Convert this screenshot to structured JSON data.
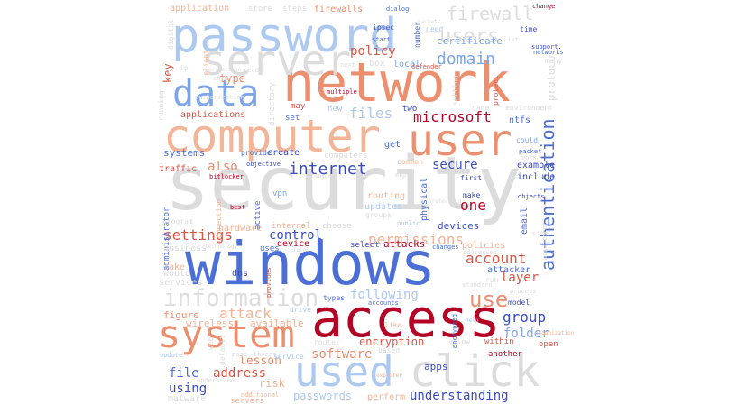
{
  "palette": {
    "darkred": "#b40426",
    "red": "#d85646",
    "salmon": "#ec8f6f",
    "lightsalmon": "#f3b497",
    "grey": "#dcdcdc",
    "lightblue": "#aec9f0",
    "blue": "#7ea5e8",
    "royal": "#4c6fd5",
    "navy": "#3b4cc0"
  },
  "words": [
    {
      "text": "security",
      "size": 82,
      "color": "grey",
      "weight": 1
    },
    {
      "text": "windows",
      "size": 66,
      "color": "royal",
      "weight": 1
    },
    {
      "text": "access",
      "size": 58,
      "color": "darkred",
      "weight": 1
    },
    {
      "text": "network",
      "size": 60,
      "color": "salmon",
      "weight": 1
    },
    {
      "text": "computer",
      "size": 50,
      "color": "lightsalmon",
      "weight": 1
    },
    {
      "text": "user",
      "size": 48,
      "color": "salmon",
      "weight": 1
    },
    {
      "text": "password",
      "size": 52,
      "color": "lightblue",
      "weight": 1
    },
    {
      "text": "server",
      "size": 46,
      "color": "grey",
      "weight": 1
    },
    {
      "text": "data",
      "size": 40,
      "color": "blue",
      "weight": 1
    },
    {
      "text": "system",
      "size": 42,
      "color": "salmon",
      "weight": 1
    },
    {
      "text": "used",
      "size": 46,
      "color": "lightblue",
      "weight": 1
    },
    {
      "text": "click",
      "size": 48,
      "color": "grey",
      "weight": 1
    },
    {
      "text": "information",
      "size": 26,
      "color": "grey",
      "weight": 1
    },
    {
      "text": "authentication",
      "size": 20,
      "color": "royal",
      "weight": 1
    },
    {
      "text": "use",
      "size": 24,
      "color": "salmon",
      "weight": 1
    },
    {
      "text": "users",
      "size": 22,
      "color": "grey",
      "weight": 1
    },
    {
      "text": "firewall",
      "size": 20,
      "color": "grey",
      "weight": 1
    },
    {
      "text": "domain",
      "size": 18,
      "color": "blue",
      "weight": 1
    },
    {
      "text": "internet",
      "size": 18,
      "color": "navy",
      "weight": 1
    },
    {
      "text": "microsoft",
      "size": 16,
      "color": "darkred",
      "weight": 1
    },
    {
      "text": "settings",
      "size": 16,
      "color": "red",
      "weight": 1
    },
    {
      "text": "permissions",
      "size": 16,
      "color": "lightsalmon",
      "weight": 1
    },
    {
      "text": "account",
      "size": 16,
      "color": "red",
      "weight": 1
    },
    {
      "text": "group",
      "size": 16,
      "color": "navy",
      "weight": 1
    },
    {
      "text": "files",
      "size": 16,
      "color": "lightblue",
      "weight": 1
    },
    {
      "text": "policy",
      "size": 14,
      "color": "red",
      "weight": 1
    },
    {
      "text": "control",
      "size": 14,
      "color": "navy",
      "weight": 1
    },
    {
      "text": "also",
      "size": 14,
      "color": "salmon",
      "weight": 1
    },
    {
      "text": "secure",
      "size": 14,
      "color": "navy",
      "weight": 1
    },
    {
      "text": "one",
      "size": 16,
      "color": "darkred",
      "weight": 1
    },
    {
      "text": "following",
      "size": 14,
      "color": "lightblue",
      "weight": 1
    },
    {
      "text": "attack",
      "size": 16,
      "color": "lightsalmon",
      "weight": 1
    },
    {
      "text": "understanding",
      "size": 14,
      "color": "navy",
      "weight": 1
    },
    {
      "text": "software",
      "size": 14,
      "color": "salmon",
      "weight": 1
    },
    {
      "text": "encryption",
      "size": 12,
      "color": "red",
      "weight": 1
    },
    {
      "text": "folder",
      "size": 14,
      "color": "blue",
      "weight": 1
    },
    {
      "text": "layer",
      "size": 14,
      "color": "red",
      "weight": 1
    },
    {
      "text": "address",
      "size": 14,
      "color": "red",
      "weight": 1
    },
    {
      "text": "file",
      "size": 14,
      "color": "royal",
      "weight": 1
    },
    {
      "text": "using",
      "size": 14,
      "color": "navy",
      "weight": 1
    },
    {
      "text": "lesson",
      "size": 13,
      "color": "salmon",
      "weight": 1
    },
    {
      "text": "risk",
      "size": 12,
      "color": "lightsalmon",
      "weight": 1
    },
    {
      "text": "type",
      "size": 12,
      "color": "salmon",
      "weight": 1
    },
    {
      "text": "key",
      "size": 12,
      "color": "red",
      "weight": 1
    },
    {
      "text": "certificate",
      "size": 11,
      "color": "blue",
      "weight": 1
    },
    {
      "text": "protocol",
      "size": 12,
      "color": "grey",
      "weight": 1
    },
    {
      "text": "passwords",
      "size": 12,
      "color": "lightblue",
      "weight": 1
    },
    {
      "text": "apps",
      "size": 11,
      "color": "navy",
      "weight": 1
    },
    {
      "text": "attacks",
      "size": 11,
      "color": "darkred",
      "weight": 1
    },
    {
      "text": "devices",
      "size": 11,
      "color": "navy",
      "weight": 1
    },
    {
      "text": "figure",
      "size": 11,
      "color": "salmon",
      "weight": 1
    },
    {
      "text": "wireless",
      "size": 11,
      "color": "lightsalmon",
      "weight": 1
    },
    {
      "text": "available",
      "size": 11,
      "color": "lightsalmon",
      "weight": 1
    },
    {
      "text": "systems",
      "size": 11,
      "color": "royal",
      "weight": 1
    },
    {
      "text": "applications",
      "size": 10,
      "color": "red",
      "weight": 1
    },
    {
      "text": "create",
      "size": 10,
      "color": "navy",
      "weight": 1
    },
    {
      "text": "updates",
      "size": 10,
      "color": "lightblue",
      "weight": 1
    },
    {
      "text": "routing",
      "size": 10,
      "color": "lightsalmon",
      "weight": 1
    },
    {
      "text": "email",
      "size": 10,
      "color": "royal",
      "weight": 1
    },
    {
      "text": "physical",
      "size": 10,
      "color": "royal",
      "weight": 1
    },
    {
      "text": "example",
      "size": 10,
      "color": "navy",
      "weight": 1
    },
    {
      "text": "include",
      "size": 10,
      "color": "navy",
      "weight": 1
    },
    {
      "text": "attacker",
      "size": 10,
      "color": "royal",
      "weight": 1
    },
    {
      "text": "policies",
      "size": 10,
      "color": "lightsalmon",
      "weight": 1
    },
    {
      "text": "traffic",
      "size": 10,
      "color": "red",
      "weight": 1
    },
    {
      "text": "hardware",
      "size": 10,
      "color": "lightsalmon",
      "weight": 1
    },
    {
      "text": "administrator",
      "size": 9,
      "color": "royal",
      "weight": 1
    },
    {
      "text": "dns",
      "size": 10,
      "color": "navy",
      "weight": 1
    },
    {
      "text": "get",
      "size": 10,
      "color": "royal",
      "weight": 1
    },
    {
      "text": "ntfs",
      "size": 10,
      "color": "royal",
      "weight": 1
    },
    {
      "text": "application",
      "size": 10,
      "color": "lightsalmon",
      "weight": 1
    },
    {
      "text": "store",
      "size": 9,
      "color": "grey",
      "weight": 1
    },
    {
      "text": "steps",
      "size": 9,
      "color": "grey",
      "weight": 1
    },
    {
      "text": "firewalls",
      "size": 10,
      "color": "salmon",
      "weight": 1
    },
    {
      "text": "directory",
      "size": 9,
      "color": "grey",
      "weight": 1
    },
    {
      "text": "business",
      "size": 10,
      "color": "grey",
      "weight": 1
    },
    {
      "text": "take",
      "size": 10,
      "color": "lightsalmon",
      "weight": 1
    },
    {
      "text": "would",
      "size": 10,
      "color": "grey",
      "weight": 1
    },
    {
      "text": "services",
      "size": 10,
      "color": "grey",
      "weight": 1
    },
    {
      "text": "malware",
      "size": 10,
      "color": "grey",
      "weight": 1
    },
    {
      "text": "servers",
      "size": 9,
      "color": "lightsalmon",
      "weight": 1
    },
    {
      "text": "perform",
      "size": 10,
      "color": "lightsalmon",
      "weight": 1
    },
    {
      "text": "another",
      "size": 9,
      "color": "darkred",
      "weight": 1
    },
    {
      "text": "within",
      "size": 9,
      "color": "red",
      "weight": 1
    },
    {
      "text": "open",
      "size": 9,
      "color": "red",
      "weight": 1
    },
    {
      "text": "select",
      "size": 9,
      "color": "navy",
      "weight": 1
    },
    {
      "text": "choose",
      "size": 9,
      "color": "grey",
      "weight": 1
    },
    {
      "text": "box",
      "size": 10,
      "color": "grey",
      "weight": 1
    },
    {
      "text": "local",
      "size": 10,
      "color": "blue",
      "weight": 1
    },
    {
      "text": "vpn",
      "size": 9,
      "color": "blue",
      "weight": 1
    },
    {
      "text": "internal",
      "size": 9,
      "color": "lightsalmon",
      "weight": 1
    },
    {
      "text": "device",
      "size": 10,
      "color": "darkred",
      "weight": 1
    },
    {
      "text": "uses",
      "size": 9,
      "color": "royal",
      "weight": 1
    },
    {
      "text": "active",
      "size": 9,
      "color": "royal",
      "weight": 1
    },
    {
      "text": "set",
      "size": 9,
      "color": "royal",
      "weight": 1
    },
    {
      "text": "two",
      "size": 9,
      "color": "navy",
      "weight": 1
    },
    {
      "text": "new",
      "size": 9,
      "color": "lightblue",
      "weight": 1
    },
    {
      "text": "may",
      "size": 9,
      "color": "red",
      "weight": 1
    },
    {
      "text": "computers",
      "size": 9,
      "color": "grey",
      "weight": 1
    },
    {
      "text": "provide",
      "size": 8,
      "color": "royal",
      "weight": 1
    },
    {
      "text": "make",
      "size": 8,
      "color": "navy",
      "weight": 1
    },
    {
      "text": "first",
      "size": 8,
      "color": "navy",
      "weight": 1
    },
    {
      "text": "could",
      "size": 8,
      "color": "blue",
      "weight": 1
    },
    {
      "text": "many",
      "size": 8,
      "color": "grey",
      "weight": 1
    },
    {
      "text": "time",
      "size": 8,
      "color": "navy",
      "weight": 1
    },
    {
      "text": "need",
      "size": 8,
      "color": "lightblue",
      "weight": 1
    },
    {
      "text": "number",
      "size": 8,
      "color": "royal",
      "weight": 1
    },
    {
      "text": "ipsec",
      "size": 8,
      "color": "navy",
      "weight": 1
    },
    {
      "text": "start",
      "size": 7,
      "color": "royal",
      "weight": 1
    },
    {
      "text": "dialog",
      "size": 7,
      "color": "royal",
      "weight": 1
    },
    {
      "text": "change",
      "size": 7,
      "color": "darkred",
      "weight": 1
    },
    {
      "text": "networks",
      "size": 7,
      "color": "royal",
      "weight": 1
    },
    {
      "text": "support.",
      "size": 7,
      "color": "navy",
      "weight": 1
    },
    {
      "text": "next",
      "size": 7,
      "color": "grey",
      "weight": 1
    },
    {
      "text": "multiple",
      "size": 7,
      "color": "darkred",
      "weight": 1
    },
    {
      "text": "defender",
      "size": 7,
      "color": "red",
      "weight": 1
    },
    {
      "text": "protect",
      "size": 8,
      "color": "red",
      "weight": 1
    },
    {
      "text": "setting",
      "size": 8,
      "color": "grey",
      "weight": 1
    },
    {
      "text": "environment",
      "size": 8,
      "color": "grey",
      "weight": 1
    },
    {
      "text": "name",
      "size": 8,
      "color": "grey",
      "weight": 1
    },
    {
      "text": "digital",
      "size": 8,
      "color": "grey",
      "weight": 1
    },
    {
      "text": "client",
      "size": 8,
      "color": "lightsalmon",
      "weight": 1
    },
    {
      "text": "read",
      "size": 7,
      "color": "grey",
      "weight": 1
    },
    {
      "text": "card",
      "size": 7,
      "color": "grey",
      "weight": 1
    },
    {
      "text": "authorization",
      "size": 7,
      "color": "grey",
      "weight": 1
    },
    {
      "text": "running",
      "size": 8,
      "color": "grey",
      "weight": 1
    },
    {
      "text": "ip",
      "size": 8,
      "color": "grey",
      "weight": 1
    },
    {
      "text": "bitlocker",
      "size": 7,
      "color": "darkred",
      "weight": 1
    },
    {
      "text": "objective",
      "size": 7,
      "color": "navy",
      "weight": 1
    },
    {
      "text": "common",
      "size": 8,
      "color": "lightsalmon",
      "weight": 1
    },
    {
      "text": "packet",
      "size": 7,
      "color": "royal",
      "weight": 1
    },
    {
      "text": "work",
      "size": 7,
      "color": "grey",
      "weight": 1
    },
    {
      "text": "objects",
      "size": 7,
      "color": "navy",
      "weight": 1
    },
    {
      "text": "groups",
      "size": 8,
      "color": "grey",
      "weight": 1
    },
    {
      "text": "public",
      "size": 7,
      "color": "lightblue",
      "weight": 1
    },
    {
      "text": "best",
      "size": 7,
      "color": "darkred",
      "weight": 1
    },
    {
      "text": "program",
      "size": 8,
      "color": "grey",
      "weight": 1
    },
    {
      "text": "connection",
      "size": 8,
      "color": "lightsalmon",
      "weight": 1
    },
    {
      "text": "changes",
      "size": 7,
      "color": "royal",
      "weight": 1
    },
    {
      "text": "addresses",
      "size": 7,
      "color": "grey",
      "weight": 1
    },
    {
      "text": "run",
      "size": 8,
      "color": "grey",
      "weight": 1
    },
    {
      "text": "site",
      "size": 7,
      "color": "grey",
      "weight": 1
    },
    {
      "text": "management",
      "size": 7,
      "color": "grey",
      "weight": 1
    },
    {
      "text": "process",
      "size": 7,
      "color": "grey",
      "weight": 1
    },
    {
      "text": "standard",
      "size": 7,
      "color": "grey",
      "weight": 1
    },
    {
      "text": "model",
      "size": 8,
      "color": "navy",
      "weight": 1
    },
    {
      "text": "accounts",
      "size": 7,
      "color": "royal",
      "weight": 1
    },
    {
      "text": "like",
      "size": 8,
      "color": "lightsalmon",
      "weight": 1
    },
    {
      "text": "drive",
      "size": 8,
      "color": "lightblue",
      "weight": 1
    },
    {
      "text": "types",
      "size": 8,
      "color": "royal",
      "weight": 1
    },
    {
      "text": "router",
      "size": 8,
      "color": "grey",
      "weight": 1
    },
    {
      "text": "allow",
      "size": 8,
      "color": "grey",
      "weight": 1
    },
    {
      "text": "based",
      "size": 8,
      "color": "grey",
      "weight": 1
    },
    {
      "text": "web",
      "size": 8,
      "color": "grey",
      "weight": 1
    },
    {
      "text": "default",
      "size": 8,
      "color": "grey",
      "weight": 1
    },
    {
      "text": "page",
      "size": 7,
      "color": "grey",
      "weight": 1
    },
    {
      "text": "threat",
      "size": 7,
      "color": "grey",
      "weight": 1
    },
    {
      "text": "service",
      "size": 8,
      "color": "lightblue",
      "weight": 1
    },
    {
      "text": "update",
      "size": 7,
      "color": "lightblue",
      "weight": 1
    },
    {
      "text": "understand",
      "size": 7,
      "color": "grey",
      "weight": 1
    },
    {
      "text": "additional",
      "size": 7,
      "color": "lightsalmon",
      "weight": 1
    },
    {
      "text": "encrypted",
      "size": 7,
      "color": "royal",
      "weight": 1
    },
    {
      "text": "explorer",
      "size": 6,
      "color": "lightsalmon",
      "weight": 1
    },
    {
      "text": "organization",
      "size": 6,
      "color": "lightsalmon",
      "weight": 1
    },
    {
      "text": "help",
      "size": 6,
      "color": "lightblue",
      "weight": 1
    },
    {
      "text": "provides",
      "size": 7,
      "color": "red",
      "weight": 1
    },
    {
      "text": "packets",
      "size": 6,
      "color": "grey",
      "weight": 1
    },
    {
      "text": "list",
      "size": 7,
      "color": "grey",
      "weight": 1
    },
    {
      "text": "protection",
      "size": 6,
      "color": "grey",
      "weight": 1
    },
    {
      "text": "protecting",
      "size": 6,
      "color": "grey",
      "weight": 1
    },
    {
      "text": "might",
      "size": 6,
      "color": "grey",
      "weight": 1
    },
    {
      "text": "ensure",
      "size": 6,
      "color": "grey",
      "weight": 1
    },
    {
      "text": "technology",
      "size": 6,
      "color": "grey",
      "weight": 1
    },
    {
      "text": "roles",
      "size": 6,
      "color": "grey",
      "weight": 1
    }
  ]
}
